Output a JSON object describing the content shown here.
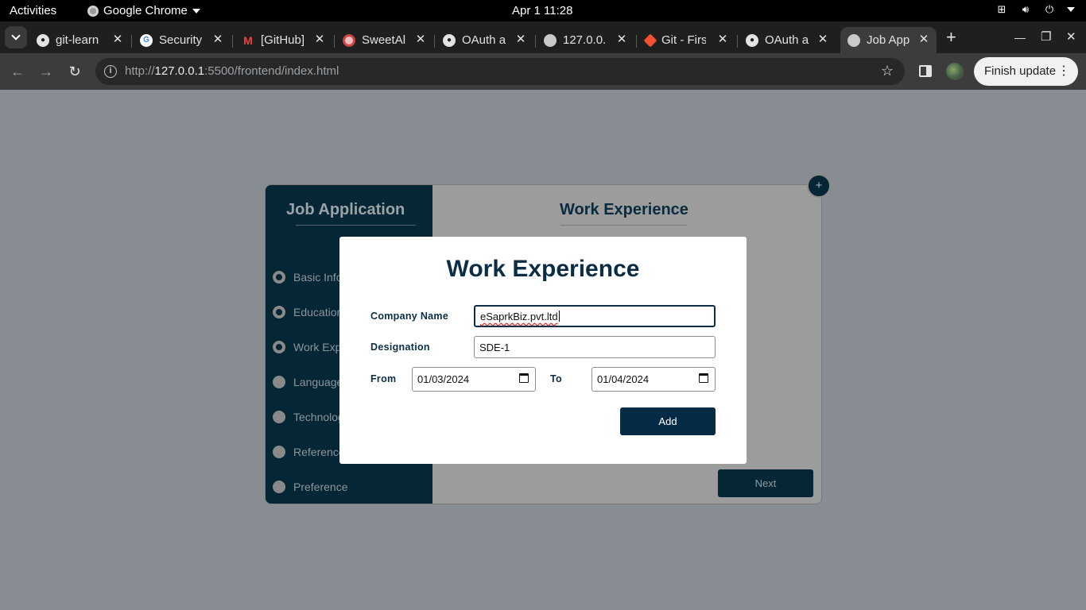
{
  "os_topbar": {
    "activities": "Activities",
    "app_name": "Google Chrome",
    "clock": "Apr 1  11:28"
  },
  "browser": {
    "tabs": [
      {
        "title": "git-learn",
        "icon": "github-icon"
      },
      {
        "title": "Security",
        "icon": "google-icon"
      },
      {
        "title": "[GitHub]",
        "icon": "gmail-icon"
      },
      {
        "title": "SweetAl",
        "icon": "sweetalert-icon"
      },
      {
        "title": "OAuth a",
        "icon": "github-icon"
      },
      {
        "title": "127.0.0.",
        "icon": "globe-icon"
      },
      {
        "title": "Git - Firs",
        "icon": "git-icon"
      },
      {
        "title": "OAuth a",
        "icon": "github-icon"
      },
      {
        "title": "Job App",
        "icon": "globe-icon"
      }
    ],
    "url_prefix": "http://",
    "url_host": "127.0.0.1",
    "url_rest": ":5500/frontend/index.html",
    "finish_update": "Finish update"
  },
  "app": {
    "sidebar_title": "Job Application",
    "steps": [
      {
        "label": "Basic Info",
        "done": true
      },
      {
        "label": "Education",
        "done": true
      },
      {
        "label": "Work Exp",
        "done": true
      },
      {
        "label": "Language",
        "done": false
      },
      {
        "label": "Technolog",
        "done": false
      },
      {
        "label": "Reference",
        "done": false
      },
      {
        "label": "Preference",
        "done": false
      }
    ],
    "main_title": "Work Experience",
    "next_label": "Next",
    "add_fab": "+"
  },
  "modal": {
    "title": "Work Experience",
    "company_label": "Company Name",
    "company_value": "eSaprkBiz.pvt.ltd",
    "designation_label": "Designation",
    "designation_value": "SDE-1",
    "from_label": "From",
    "from_value": "01/03/2024",
    "to_label": "To",
    "to_value": "01/04/2024",
    "add_label": "Add"
  },
  "colors": {
    "navy": "#052635",
    "overlay": "#888d93",
    "heading": "#0b2d45"
  }
}
